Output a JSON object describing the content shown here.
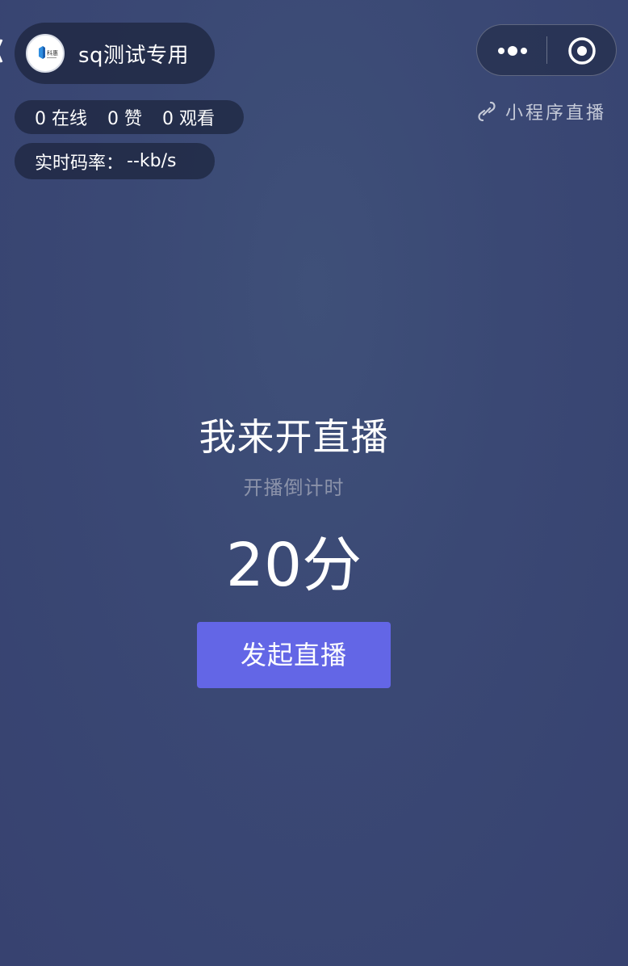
{
  "host": {
    "name": "sq测试专用",
    "avatar_text": "科惠"
  },
  "stats": {
    "online_count": "0",
    "online_label": "在线",
    "likes_count": "0",
    "likes_label": "赞",
    "views_count": "0",
    "views_label": "观看"
  },
  "bitrate": {
    "label": "实时码率：",
    "value": "--kb/s"
  },
  "capsule": {
    "more_icon": "more-dots-icon",
    "close_icon": "record-circle-icon"
  },
  "mini_program_tag": {
    "icon": "link-icon",
    "label": "小程序直播"
  },
  "live": {
    "title": "我来开直播",
    "countdown_label": "开播倒计时",
    "countdown_value": "20分",
    "start_button": "发起直播"
  },
  "colors": {
    "background": "#3a4874",
    "button": "#6366e6",
    "subtext": "#8c93aa"
  }
}
